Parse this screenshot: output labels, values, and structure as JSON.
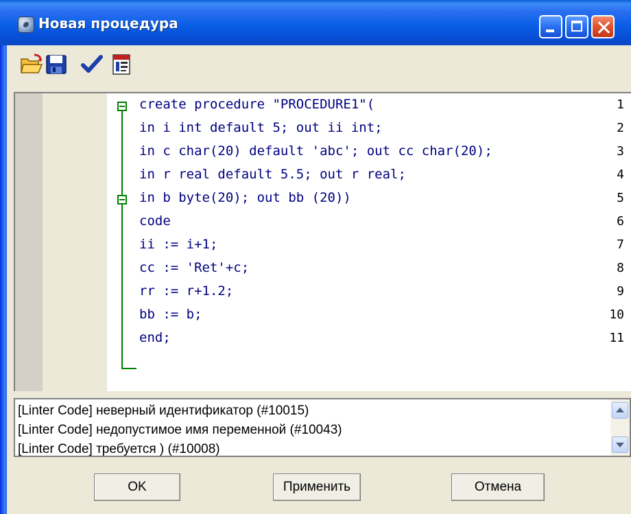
{
  "window": {
    "title": "Новая процедура"
  },
  "toolbar": {
    "icons": [
      "open-folder-icon",
      "save-disk-icon",
      "check-icon",
      "properties-icon"
    ]
  },
  "editor": {
    "lines": [
      {
        "num": "1",
        "text": "create procedure \"PROCEDURE1\"("
      },
      {
        "num": "2",
        "text": "in i int default 5; out ii int;"
      },
      {
        "num": "3",
        "text": "in c char(20) default 'abc'; out cc char(20);"
      },
      {
        "num": "4",
        "text": "in r real default 5.5; out r real;"
      },
      {
        "num": "5",
        "text": "in b byte(20); out bb (20))"
      },
      {
        "num": "6",
        "text": "code"
      },
      {
        "num": "7",
        "text": "ii := i+1;"
      },
      {
        "num": "8",
        "text": "cc := 'Ret'+c;"
      },
      {
        "num": "9",
        "text": "rr := r+1.2;"
      },
      {
        "num": "10",
        "text": "bb := b;"
      },
      {
        "num": "11",
        "text": "end;"
      }
    ]
  },
  "messages": [
    "[Linter Code] неверный идентификатор (#10015)",
    "[Linter Code] недопустимое имя переменной (#10043)",
    "[Linter Code] требуется ) (#10008)"
  ],
  "buttons": {
    "ok": "OK",
    "apply": "Применить",
    "cancel": "Отмена"
  },
  "colors": {
    "keyword": "#000080",
    "fold": "#008000",
    "title_bar": "#0a5fe6"
  }
}
